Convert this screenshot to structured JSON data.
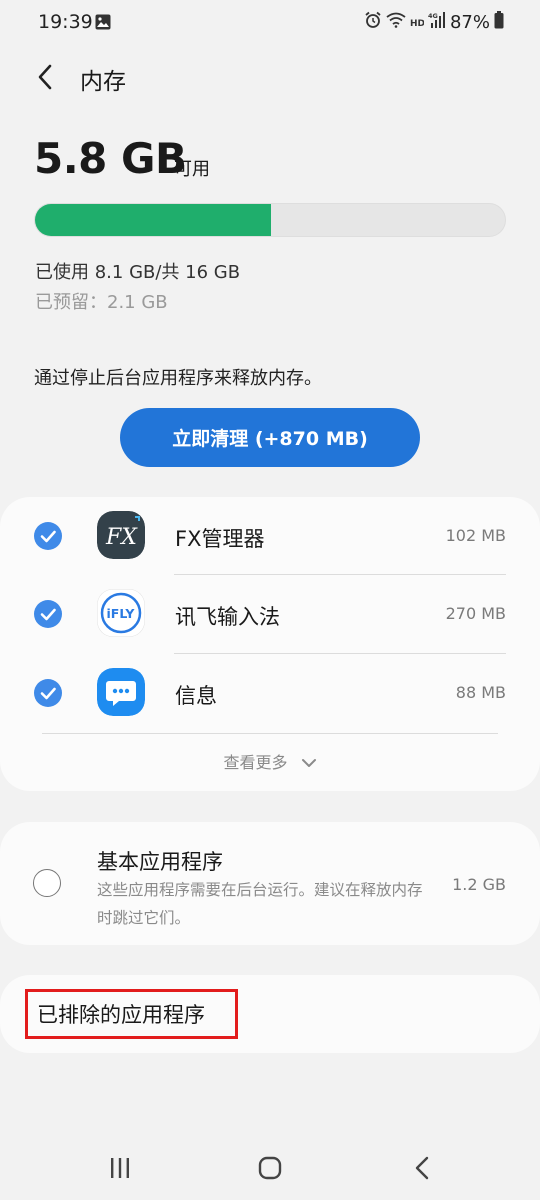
{
  "status_bar": {
    "time": "19:39",
    "battery_percent": "87%",
    "icons": [
      "gallery-icon",
      "alarm-icon",
      "wifi-icon",
      "hd-icon",
      "4g-signal-icon",
      "battery-icon"
    ]
  },
  "header": {
    "title": "内存",
    "back_icon": "back-chevron-icon"
  },
  "memory": {
    "available_value": "5.8 GB",
    "available_label": "可用",
    "used_fraction": 0.503,
    "used_text": "已使用 8.1 GB/共 16 GB",
    "reserved_text": "已预留：2.1 GB",
    "bar_fill_color": "#1fae6c"
  },
  "description": "通过停止后台应用程序来释放内存。",
  "clean_button_label": "立即清理 (+870 MB)",
  "apps": [
    {
      "name": "FX管理器",
      "size": "102 MB",
      "checked": true,
      "icon": "fx-manager-icon"
    },
    {
      "name": "讯飞输入法",
      "size": "270 MB",
      "checked": true,
      "icon": "ifly-input-icon"
    },
    {
      "name": "信息",
      "size": "88 MB",
      "checked": true,
      "icon": "messages-icon"
    }
  ],
  "see_more_label": "查看更多",
  "essential": {
    "title": "基本应用程序",
    "description": "这些应用程序需要在后台运行。建议在释放内存时跳过它们。",
    "size": "1.2 GB",
    "checked": false
  },
  "excluded_label": "已排除的应用程序",
  "nav": {
    "icons": [
      "recents-icon",
      "home-icon",
      "back-icon"
    ]
  },
  "colors": {
    "accent": "#2275d8",
    "check": "#3f8ae8",
    "highlight_box": "#e21c1c"
  }
}
